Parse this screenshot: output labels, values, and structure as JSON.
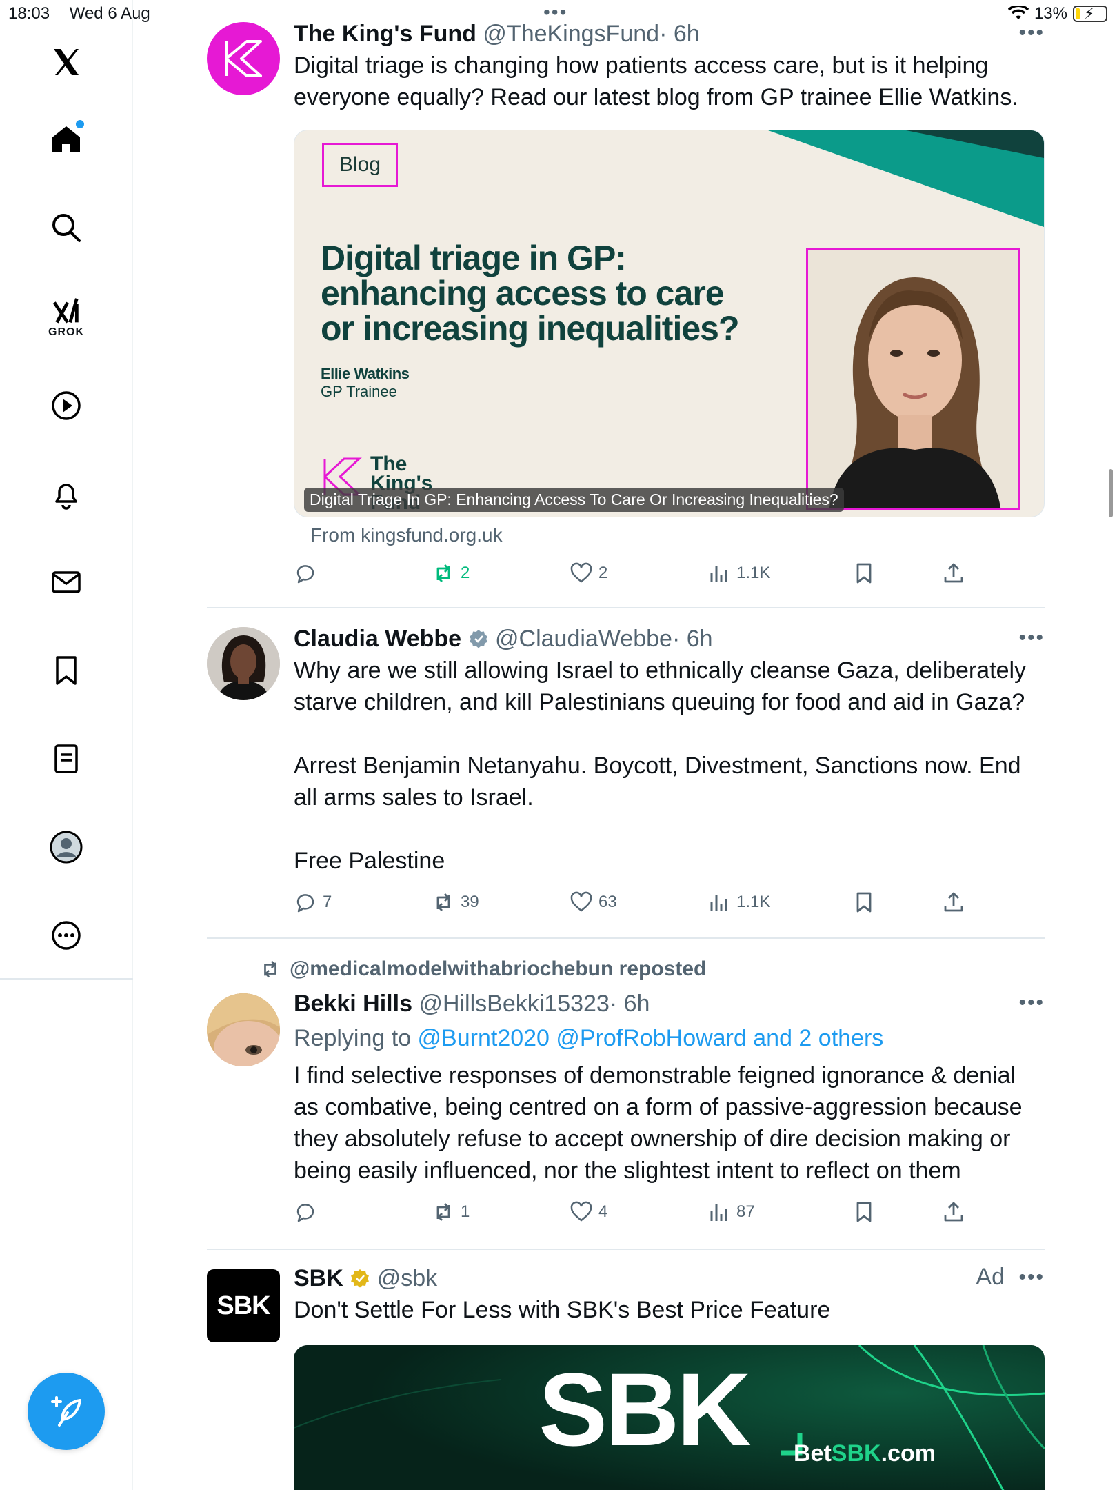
{
  "status": {
    "time": "18:03",
    "date": "Wed 6 Aug",
    "battery": "13%",
    "battery_level": 0.13
  },
  "sidebar": {
    "items": [
      "home",
      "search",
      "grok",
      "video",
      "notifications",
      "messages",
      "bookmarks",
      "lists",
      "profile",
      "more"
    ],
    "grok_label": "GROK"
  },
  "tweets": [
    {
      "name": "The King's Fund",
      "handle": "@TheKingsFund",
      "time": "· 6h",
      "text": "Digital triage is changing how patients access care, but is it helping everyone equally? Read our latest blog from GP trainee Ellie Watkins.",
      "card": {
        "tag": "Blog",
        "title": "Digital triage in GP: enhancing access to care or increasing inequalities?",
        "author": "Ellie Watkins",
        "author_role": "GP Trainee",
        "logo": "The King's Fund",
        "caption": "Digital Triage In GP: Enhancing Access To Care Or Increasing Inequalities?",
        "from": "From kingsfund.org.uk"
      },
      "stats": {
        "replies": "",
        "reposts": "2",
        "likes": "2",
        "views": "1.1K"
      }
    },
    {
      "name": "Claudia Webbe",
      "handle": "@ClaudiaWebbe",
      "time": "· 6h",
      "paragraphs": [
        "Why are we still allowing Israel to ethnically cleanse Gaza, deliberately starve children, and kill Palestinians queuing for food and aid in Gaza?",
        "Arrest Benjamin Netanyahu. Boycott, Divestment, Sanctions now. End all arms sales to Israel.",
        "Free Palestine"
      ],
      "stats": {
        "replies": "7",
        "reposts": "39",
        "likes": "63",
        "views": "1.1K"
      }
    },
    {
      "repost_by": "@medicalmodelwithabriochebun reposted",
      "name": "Bekki Hills",
      "handle": "@HillsBekki15323",
      "time": "· 6h",
      "replying_prefix": "Replying to ",
      "replying_to": "@Burnt2020 @ProfRobHoward and 2 others",
      "text": "I find selective responses of demonstrable feigned ignorance & denial as combative, being centred on a form of passive-aggression because they absolutely refuse to accept ownership of dire decision making or being easily influenced, nor the slightest intent to reflect on them",
      "stats": {
        "replies": "",
        "reposts": "1",
        "likes": "4",
        "views": "87"
      }
    },
    {
      "name": "SBK",
      "handle": "@sbk",
      "ad_label": "Ad",
      "text": "Don't Settle For Less with SBK's Best Price Feature",
      "avatar_text": "SBK",
      "banner_text": "SBK",
      "banner_url_prefix": "Bet",
      "banner_url_brand": "SBK",
      "banner_url_suffix": ".com"
    }
  ],
  "colors": {
    "accent": "#1d9bf0",
    "repost_active": "#00ba7c",
    "kings_fund_magenta": "#e619d4",
    "kings_fund_teal": "#10423d"
  }
}
